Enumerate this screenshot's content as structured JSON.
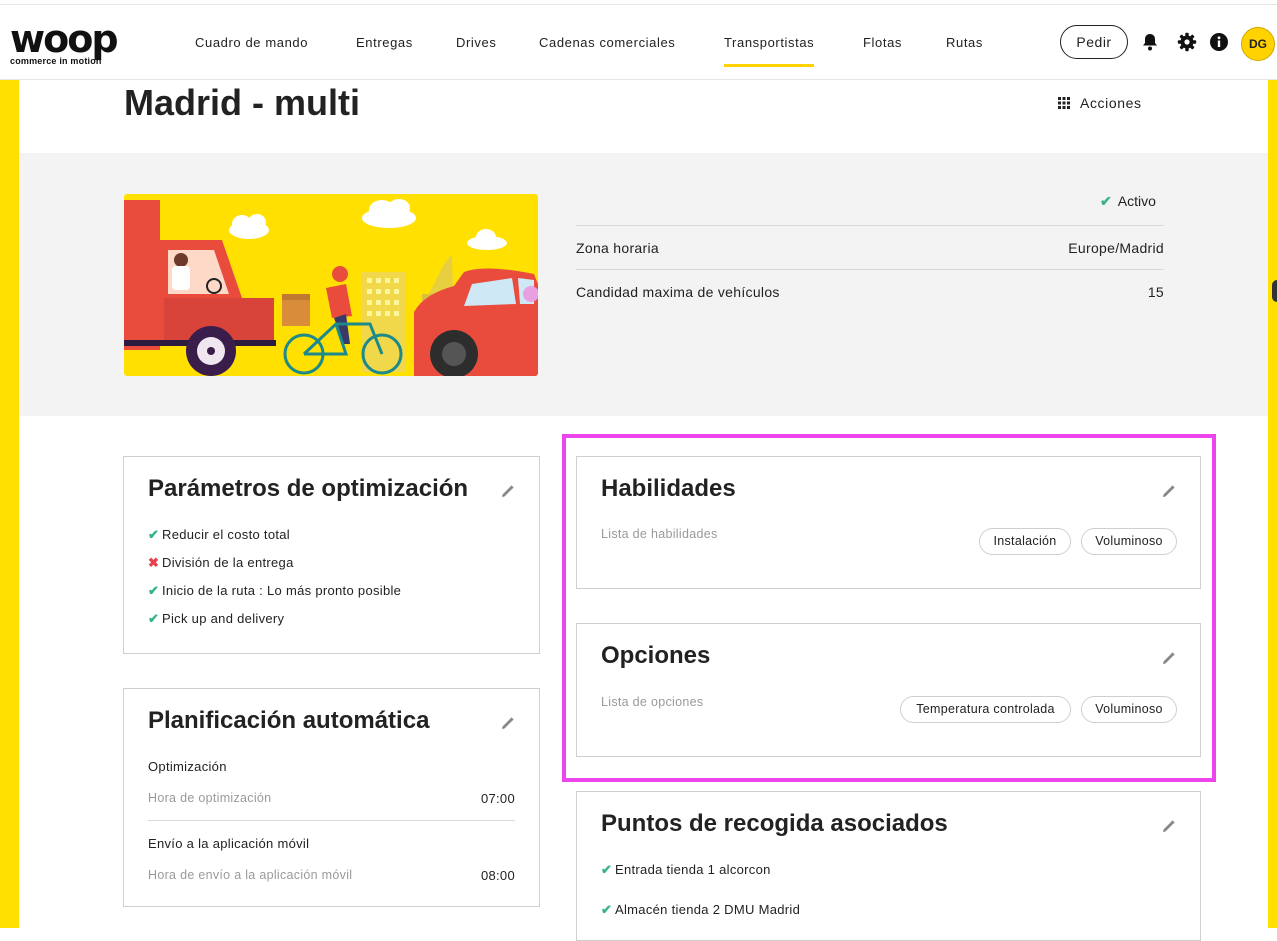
{
  "nav": {
    "logo_word": "woop",
    "logo_tagline": "commerce in motion",
    "items": [
      {
        "label": "Cuadro de mando"
      },
      {
        "label": "Entregas"
      },
      {
        "label": "Drives"
      },
      {
        "label": "Cadenas comerciales"
      },
      {
        "label": "Transportistas",
        "active": true
      },
      {
        "label": "Flotas"
      },
      {
        "label": "Rutas"
      }
    ],
    "pedir_label": "Pedir",
    "avatar_initials": "DG",
    "icons": [
      "bell-icon",
      "gear-icon",
      "info-icon"
    ]
  },
  "page": {
    "title": "Madrid - multi",
    "acciones_label": "Acciones"
  },
  "summary": {
    "status": "Activo",
    "rows": [
      {
        "label": "Zona horaria",
        "value": "Europe/Madrid"
      },
      {
        "label": "Candidad maxima de vehículos",
        "value": "15"
      }
    ]
  },
  "optimization": {
    "title": "Parámetros de optimización",
    "items": [
      {
        "label": "Reducir el costo total",
        "ok": true
      },
      {
        "label": "División de la entrega",
        "ok": false
      },
      {
        "label": "Inicio de la ruta : Lo más pronto posible",
        "ok": true
      },
      {
        "label": "Pick up and delivery",
        "ok": true
      }
    ]
  },
  "planning": {
    "title": "Planificación automática",
    "sections": [
      {
        "heading": "Optimización",
        "label": "Hora de optimización",
        "value": "07:00"
      },
      {
        "heading": "Envío a la aplicación móvil",
        "label": "Hora de envío a la aplicación móvil",
        "value": "08:00"
      }
    ]
  },
  "skills": {
    "title": "Habilidades",
    "list_label": "Lista de habilidades",
    "chips": [
      "Instalación",
      "Voluminoso"
    ]
  },
  "options": {
    "title": "Opciones",
    "list_label": "Lista de opciones",
    "chips": [
      "Temperatura controlada",
      "Voluminoso"
    ]
  },
  "pickup": {
    "title": "Puntos de recogida asociados",
    "items": [
      "Entrada tienda 1 alcorcon",
      "Almacén tienda 2 DMU Madrid"
    ]
  },
  "colors": {
    "brand_yellow": "#FFD200",
    "ok_green": "#35b38a",
    "error_red": "#e8414c",
    "highlight_magenta": "#ee44ee"
  }
}
